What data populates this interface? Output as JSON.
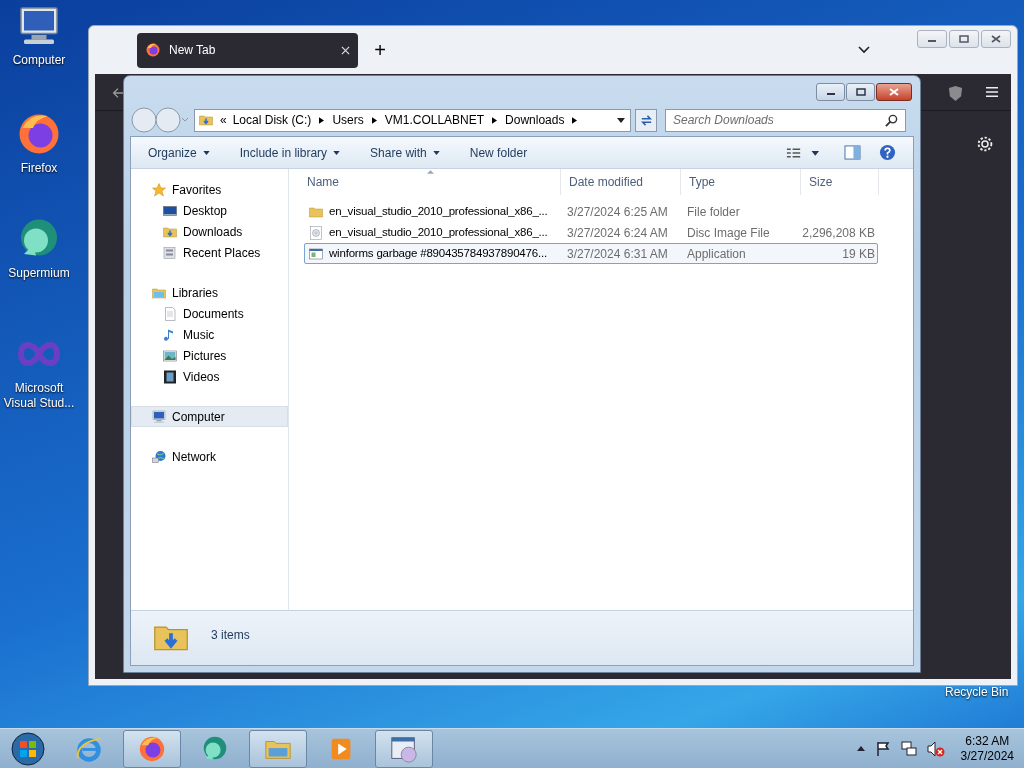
{
  "desktop_icons": [
    {
      "kind": "computer",
      "label": "Computer"
    },
    {
      "kind": "firefox",
      "label": "Firefox"
    },
    {
      "kind": "supermium",
      "label": "Supermium"
    },
    {
      "kind": "vs",
      "label": "Microsoft Visual Stud..."
    }
  ],
  "recycle_bin_label": "Recycle Bin",
  "browser": {
    "tabs": [
      {
        "title": "New Tab",
        "selected": true
      }
    ],
    "new_tab": "+"
  },
  "explorer": {
    "breadcrumb_overflow": "«",
    "breadcrumb": [
      "Local Disk (C:)",
      "Users",
      "VM1.COLLABNET",
      "Downloads"
    ],
    "search": {
      "placeholder": "Search Downloads"
    },
    "commands": [
      {
        "label": "Organize",
        "kind": "menu"
      },
      {
        "label": "Include in library",
        "kind": "menu"
      },
      {
        "label": "Share with",
        "kind": "menu"
      },
      {
        "label": "New folder",
        "kind": "plain"
      }
    ],
    "nav": [
      {
        "label": "Favorites",
        "kind": "star",
        "selected": false,
        "children": [
          {
            "label": "Desktop",
            "kind": "desktop",
            "selected": false
          },
          {
            "label": "Downloads",
            "kind": "downloads",
            "selected": false
          },
          {
            "label": "Recent Places",
            "kind": "recent",
            "selected": false
          }
        ]
      },
      {
        "label": "Libraries",
        "kind": "libraries",
        "selected": false,
        "children": [
          {
            "label": "Documents",
            "kind": "documents",
            "selected": false
          },
          {
            "label": "Music",
            "kind": "music",
            "selected": false
          },
          {
            "label": "Pictures",
            "kind": "pictures",
            "selected": false
          },
          {
            "label": "Videos",
            "kind": "videos",
            "selected": false
          }
        ]
      },
      {
        "label": "Computer",
        "kind": "computer",
        "selected": true
      },
      {
        "label": "Network",
        "kind": "network",
        "selected": false
      }
    ],
    "columns": [
      "Name",
      "Date modified",
      "Type",
      "Size"
    ],
    "files": [
      {
        "kind": "folder",
        "name": "en_visual_studio_2010_professional_x86_...",
        "date": "3/27/2024 6:25 AM",
        "type": "File folder",
        "selected": false
      },
      {
        "kind": "disc",
        "name": "en_visual_studio_2010_professional_x86_...",
        "date": "3/27/2024 6:24 AM",
        "type": "Disc Image File",
        "size": "2,296,208 KB",
        "selected": false
      },
      {
        "kind": "app",
        "name": "winforms garbage #890435784937890476...",
        "date": "3/27/2024 6:31 AM",
        "type": "Application",
        "size": "19 KB",
        "selected": true
      }
    ],
    "status": "3 items"
  },
  "taskbar": {
    "apps": [
      {
        "kind": "ie",
        "open": false
      },
      {
        "kind": "firefox",
        "open": true
      },
      {
        "kind": "supermium",
        "open": false
      },
      {
        "kind": "explorer",
        "open": true
      },
      {
        "kind": "media",
        "open": false
      },
      {
        "kind": "dvd",
        "open": true
      }
    ],
    "clock": {
      "time": "6:32 AM",
      "date": "3/27/2024"
    }
  }
}
